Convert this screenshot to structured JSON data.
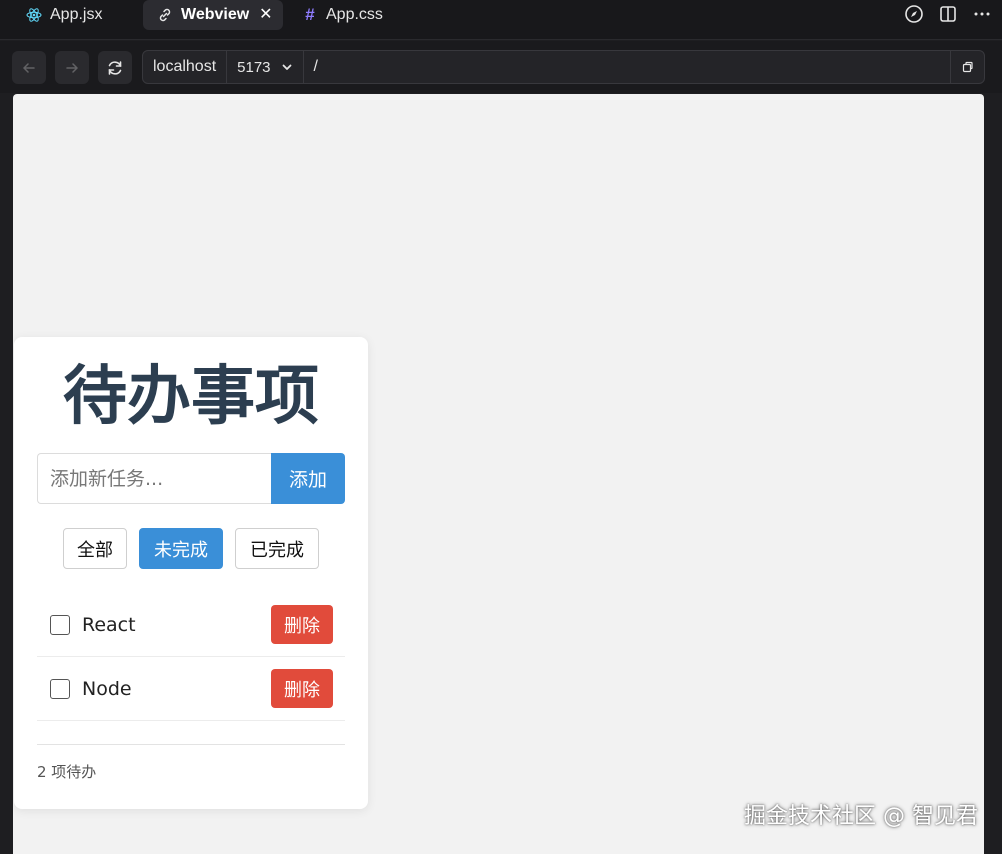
{
  "editor": {
    "tabs": [
      {
        "label": "App.jsx",
        "icon": "react-icon",
        "active": false
      },
      {
        "label": "Webview",
        "icon": "webview-icon",
        "active": true
      },
      {
        "label": "App.css",
        "icon": "hash-icon",
        "active": false
      }
    ],
    "actions": [
      "compass-icon",
      "split-editor-icon",
      "more-icon"
    ]
  },
  "browser": {
    "host": "localhost",
    "port": "5173",
    "path": "/"
  },
  "app": {
    "title": "待办事项",
    "input_placeholder": "添加新任务...",
    "add_label": "添加",
    "filters": [
      {
        "label": "全部",
        "active": false
      },
      {
        "label": "未完成",
        "active": true
      },
      {
        "label": "已完成",
        "active": false
      }
    ],
    "todos": [
      {
        "text": "React",
        "checked": false,
        "delete_label": "删除"
      },
      {
        "text": "Node",
        "checked": false,
        "delete_label": "删除"
      }
    ],
    "footer": "2 项待办"
  },
  "watermark": "掘金技术社区 @ 智见君",
  "colors": {
    "primary": "#3a8fd8",
    "danger": "#e14b3b",
    "title": "#2c3e50"
  }
}
